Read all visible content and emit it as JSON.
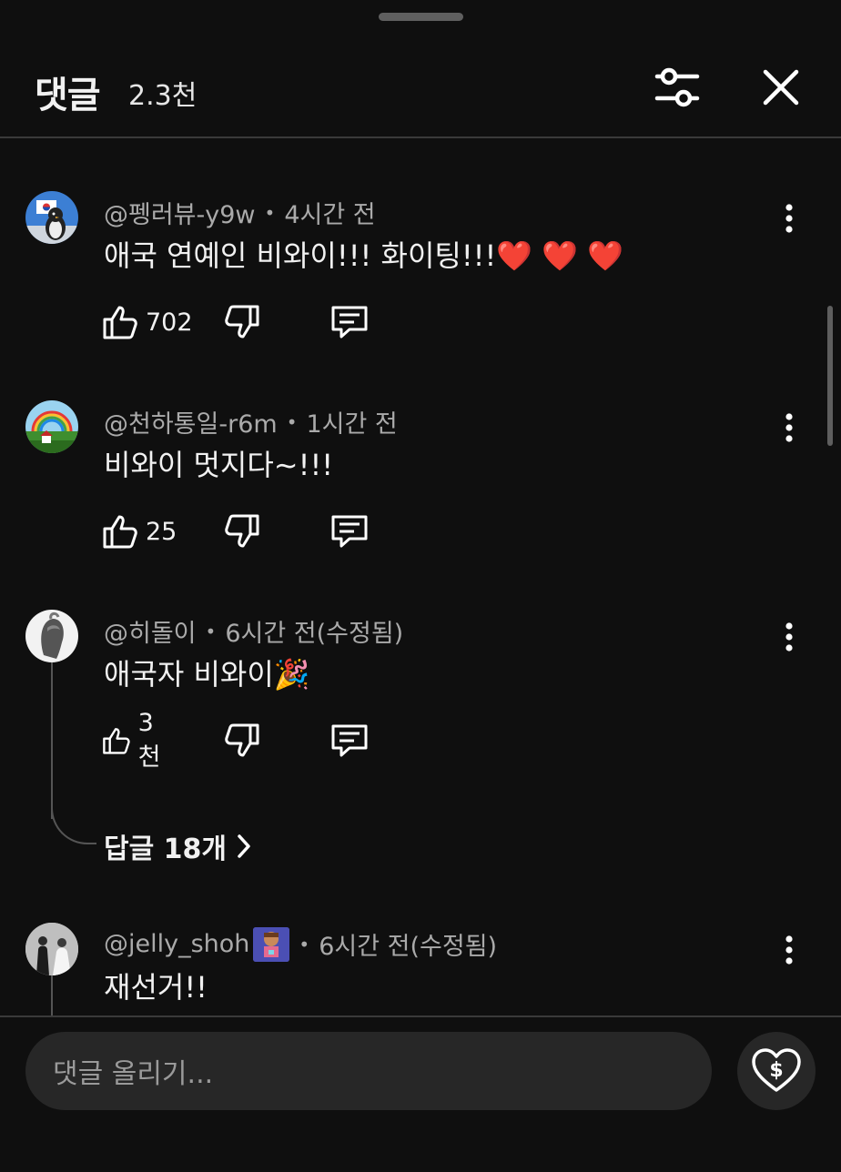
{
  "header": {
    "title": "댓글",
    "count": "2.3천"
  },
  "comments": [
    {
      "author": "@펭러뷰-y9w",
      "time": "4시간 전",
      "text": "애국 연예인 비와이!!! 화이팅!!!❤️ ❤️ ❤️",
      "likes": "702"
    },
    {
      "author": "@천하통일-r6m",
      "time": "1시간 전",
      "text": "비와이 멋지다~!!!",
      "likes": "25"
    },
    {
      "author": "@히돌이",
      "time": "6시간 전(수정됨)",
      "text": "애국자 비와이🎉",
      "likes": "3천",
      "replies_label": "답글 18개"
    },
    {
      "author": "@jelly_shoh",
      "time": "6시간 전(수정됨)",
      "text": "재선거!!"
    }
  ],
  "footer": {
    "input_placeholder": "댓글 올리기..."
  },
  "icons": {
    "filter": "sliders-icon",
    "close": "close-icon",
    "more": "more-vertical-icon",
    "like": "thumbs-up-icon",
    "dislike": "thumbs-down-icon",
    "reply": "comment-icon",
    "thanks": "heart-dollar-icon"
  }
}
